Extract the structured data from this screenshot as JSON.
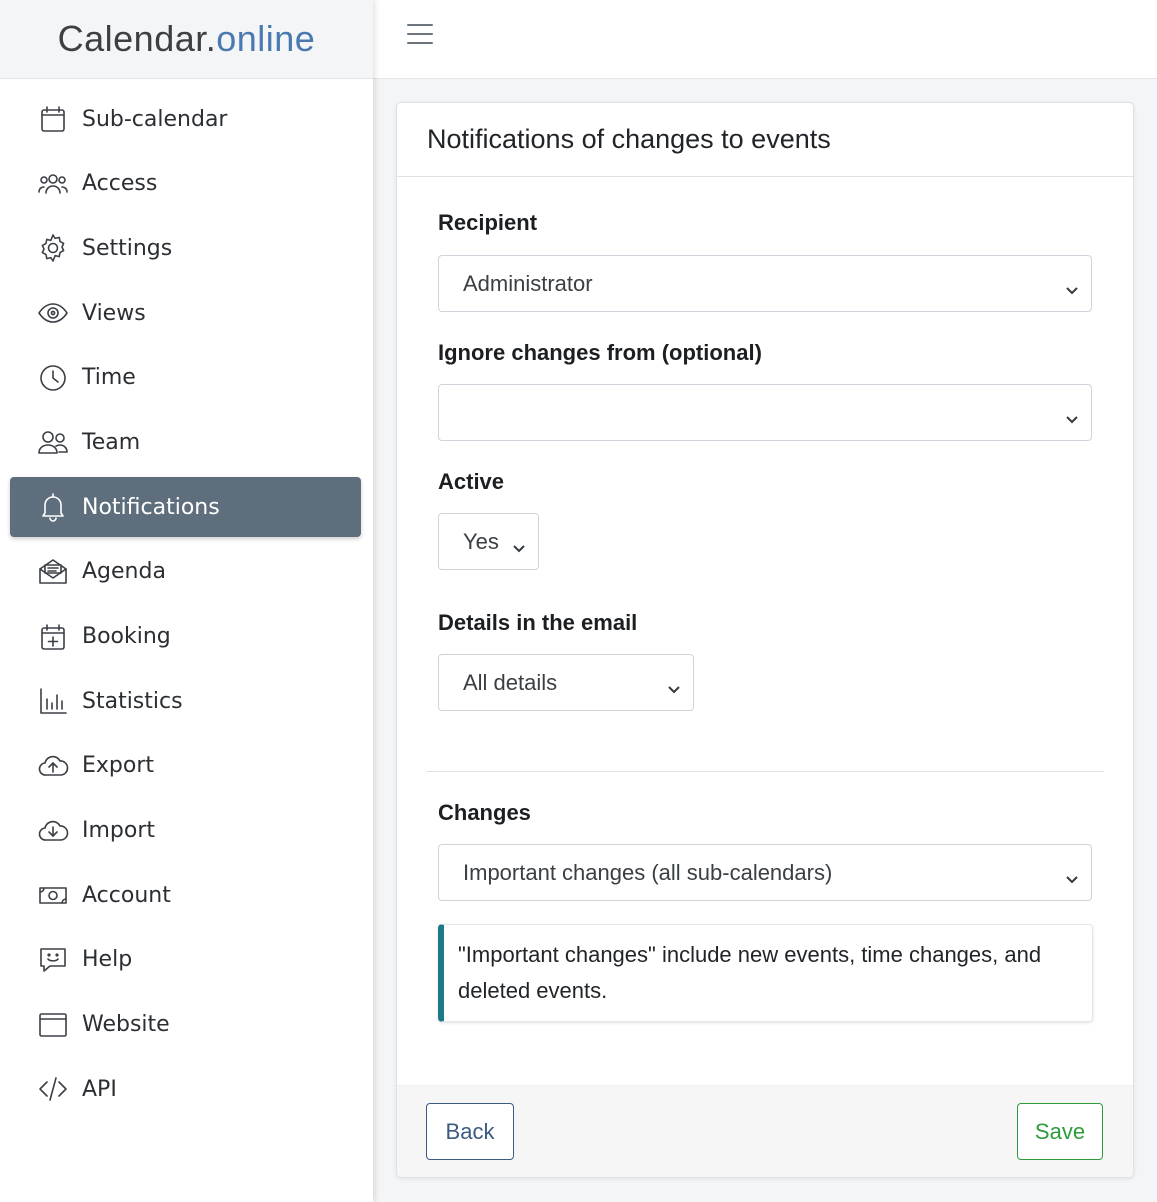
{
  "brand": {
    "part1": "Calendar.",
    "part2": "online",
    "color_primary": "#3c4043",
    "color_accent": "#4a79b0"
  },
  "sidebar": {
    "active_color": "#5f6e7c",
    "items": [
      {
        "label": "Sub-calendar",
        "icon": "calendar-icon"
      },
      {
        "label": "Access",
        "icon": "users-group-icon"
      },
      {
        "label": "Settings",
        "icon": "gear-icon"
      },
      {
        "label": "Views",
        "icon": "eye-icon"
      },
      {
        "label": "Time",
        "icon": "clock-icon"
      },
      {
        "label": "Team",
        "icon": "team-icon"
      },
      {
        "label": "Notifications",
        "icon": "bell-icon",
        "active": true
      },
      {
        "label": "Agenda",
        "icon": "envelope-open-icon"
      },
      {
        "label": "Booking",
        "icon": "calendar-plus-icon"
      },
      {
        "label": "Statistics",
        "icon": "bar-chart-icon"
      },
      {
        "label": "Export",
        "icon": "cloud-upload-icon"
      },
      {
        "label": "Import",
        "icon": "cloud-download-icon"
      },
      {
        "label": "Account",
        "icon": "cash-icon"
      },
      {
        "label": "Help",
        "icon": "chat-smile-icon"
      },
      {
        "label": "Website",
        "icon": "browser-window-icon"
      },
      {
        "label": "API",
        "icon": "code-icon"
      }
    ]
  },
  "card": {
    "title": "Notifications of changes to events",
    "recipient": {
      "label": "Recipient",
      "value": "Administrator"
    },
    "ignore": {
      "label": "Ignore changes from (optional)",
      "value": ""
    },
    "active": {
      "label": "Active",
      "value": "Yes"
    },
    "details": {
      "label": "Details in the email",
      "value": "All details"
    },
    "changes": {
      "label": "Changes",
      "value": "Important changes (all sub-calendars)"
    },
    "callout": {
      "text": "\"Important changes\" include new events, time changes, and deleted events.",
      "accent": "#1b7a87"
    },
    "back_label": "Back",
    "save_label": "Save"
  }
}
